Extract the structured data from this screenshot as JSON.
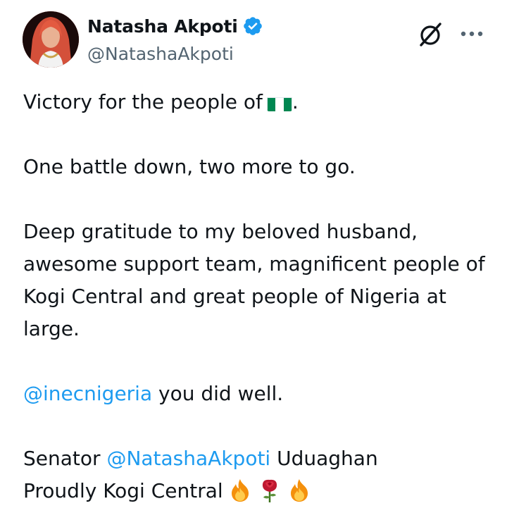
{
  "author": {
    "display_name": "Natasha Akpoti",
    "handle": "@NatashaAkpoti",
    "verified": true
  },
  "icons": {
    "verified": "verified-badge-icon",
    "grok": "grok-icon",
    "more": "more-options-icon",
    "flag": "nigeria-flag-icon",
    "fire": "fire-icon",
    "rose": "rose-icon"
  },
  "colors": {
    "text": "#0f1419",
    "secondary": "#536471",
    "link": "#1d9bf0",
    "verified": "#1d9bf0",
    "flag_green": "#008751"
  },
  "tweet": {
    "line1": "Victory for the people of",
    "line1_end": ".",
    "line2": "One battle down, two more to go.",
    "line3": "Deep gratitude to my beloved husband, awesome support team, magnificent people of Kogi Central and great people of Nigeria at large.",
    "mention1": "@inecnigeria",
    "line4_rest": " you did well.",
    "senator_prefix": "Senator ",
    "mention2": "@NatashaAkpoti",
    "senator_suffix": " Uduaghan",
    "final_line": "Proudly Kogi Central"
  }
}
